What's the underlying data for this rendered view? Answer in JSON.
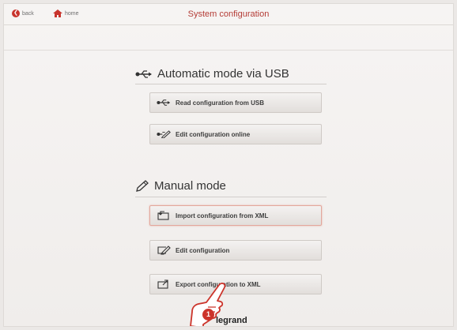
{
  "header": {
    "back_label": "back",
    "home_label": "home",
    "title": "System configuration"
  },
  "usb_section": {
    "title": "Automatic mode via USB",
    "buttons": [
      {
        "label": "Read configuration from USB",
        "icon": "usb-icon"
      },
      {
        "label": "Edit configuration online",
        "icon": "usb-edit-icon"
      }
    ]
  },
  "manual_section": {
    "title": "Manual mode",
    "buttons": [
      {
        "label": "Import configuration from XML",
        "icon": "import-icon"
      },
      {
        "label": "Edit configuration",
        "icon": "edit-icon"
      },
      {
        "label": "Export configuration to XML",
        "icon": "export-icon"
      }
    ]
  },
  "footer": {
    "brand": "legrand"
  },
  "callout": {
    "number": "1"
  },
  "colors": {
    "accent": "#b43c36",
    "badge": "#cc342b"
  }
}
